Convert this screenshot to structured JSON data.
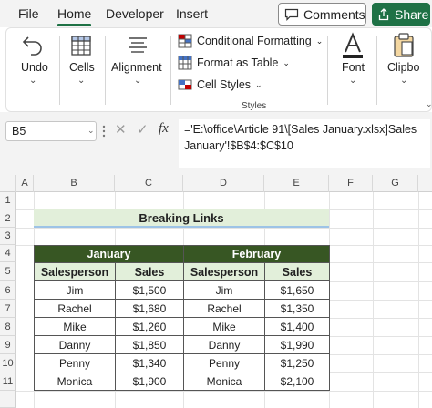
{
  "tabs": [
    "File",
    "Home",
    "Developer",
    "Insert"
  ],
  "active_tab": "Home",
  "comments_label": "Comments",
  "share_label": "Share",
  "ribbon": {
    "undo_label": "Undo",
    "cells_label": "Cells",
    "alignment_label": "Alignment",
    "styles_items": [
      "Conditional Formatting",
      "Format as Table",
      "Cell Styles"
    ],
    "styles_group_label": "Styles",
    "font_label": "Font",
    "clipboard_label": "Clipbo"
  },
  "name_box": "B5",
  "formula": "='E:\\office\\Article 91\\[Sales January.xlsx]Sales January'!$B$4:$C$10",
  "columns": [
    "A",
    "B",
    "C",
    "D",
    "E",
    "F",
    "G"
  ],
  "rows": [
    "1",
    "2",
    "3",
    "4",
    "5",
    "6",
    "7",
    "8",
    "9",
    "10",
    "11"
  ],
  "sheet": {
    "title": "Breaking Links",
    "month1": "January",
    "month2": "February",
    "headers": [
      "Salesperson",
      "Sales",
      "Salesperson",
      "Sales"
    ],
    "data": [
      [
        "Jim",
        "$1,500",
        "Jim",
        "$1,650"
      ],
      [
        "Rachel",
        "$1,680",
        "Rachel",
        "$1,350"
      ],
      [
        "Mike",
        "$1,260",
        "Mike",
        "$1,400"
      ],
      [
        "Danny",
        "$1,850",
        "Danny",
        "$1,990"
      ],
      [
        "Penny",
        "$1,340",
        "Penny",
        "$1,250"
      ],
      [
        "Monica",
        "$1,900",
        "Monica",
        "$2,100"
      ]
    ]
  },
  "colors": {
    "accent": "#1e7145",
    "header_fill": "#375623",
    "light_fill": "#e2efda"
  }
}
